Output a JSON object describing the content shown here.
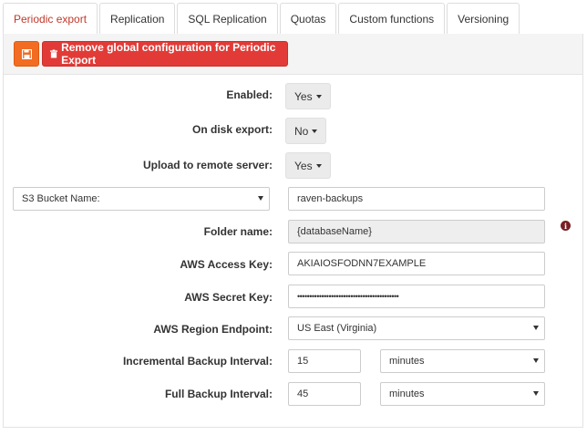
{
  "tabs": [
    {
      "label": "Periodic export",
      "active": true
    },
    {
      "label": "Replication",
      "active": false
    },
    {
      "label": "SQL Replication",
      "active": false
    },
    {
      "label": "Quotas",
      "active": false
    },
    {
      "label": "Custom functions",
      "active": false
    },
    {
      "label": "Versioning",
      "active": false
    }
  ],
  "toolbar": {
    "save_icon": "floppy-disk-icon",
    "remove_label": "Remove global configuration for Periodic Export",
    "remove_icon": "trash-icon"
  },
  "form": {
    "enabled": {
      "label": "Enabled:",
      "value": "Yes"
    },
    "on_disk_export": {
      "label": "On disk export:",
      "value": "No"
    },
    "upload_remote": {
      "label": "Upload to remote server:",
      "value": "Yes"
    },
    "bucket_type": {
      "selected": "S3 Bucket Name:"
    },
    "bucket_name": {
      "value": "raven-backups"
    },
    "folder_name": {
      "label": "Folder name:",
      "value": "{databaseName}",
      "info_icon": "info-icon"
    },
    "access_key": {
      "label": "AWS Access Key:",
      "value": "AKIAIOSFODNN7EXAMPLE"
    },
    "secret_key": {
      "label": "AWS Secret Key:",
      "value": "••••••••••••••••••••••••••••••••••••••••••"
    },
    "region": {
      "label": "AWS Region Endpoint:",
      "selected": "US East (Virginia)"
    },
    "incremental": {
      "label": "Incremental Backup Interval:",
      "value": "15",
      "unit": "minutes"
    },
    "full": {
      "label": "Full Backup Interval:",
      "value": "45",
      "unit": "minutes"
    }
  },
  "colors": {
    "active_tab_text": "#c0392b",
    "save_button": "#f26c22",
    "remove_button": "#e23b37",
    "info_icon": "#7a1f24"
  }
}
